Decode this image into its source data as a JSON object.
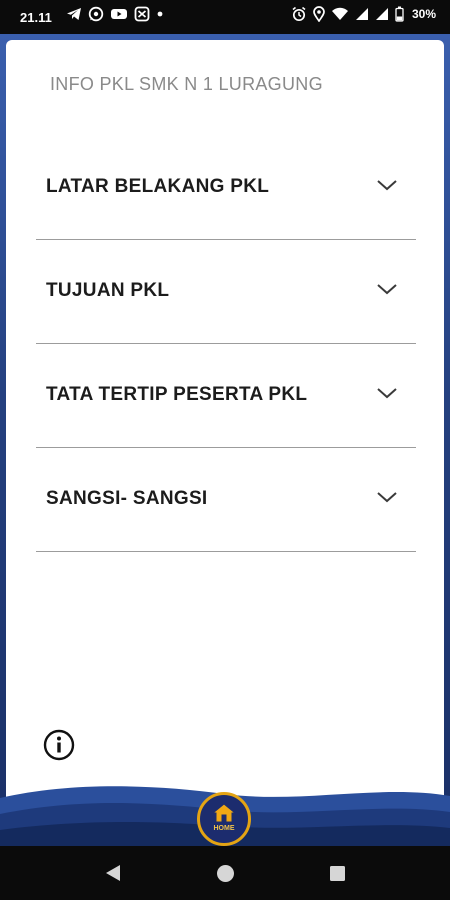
{
  "status_bar": {
    "time": "21.11",
    "battery": "30%",
    "icons": [
      "telegram-icon",
      "whatsapp-icon",
      "youtube-icon",
      "capcut-icon",
      "dot-icon",
      "alarm-icon",
      "location-icon",
      "wifi-icon",
      "signal-icon",
      "signal-icon",
      "battery-icon"
    ]
  },
  "app": {
    "title": "INFO PKL SMK N 1 LURAGUNG",
    "sections": [
      {
        "label": "LATAR BELAKANG PKL"
      },
      {
        "label": "TUJUAN PKL"
      },
      {
        "label": "TATA TERTIP PESERTA PKL"
      },
      {
        "label": "SANGSI- SANGSI"
      }
    ],
    "home_button": {
      "label": "HOME"
    }
  },
  "colors": {
    "frame_blue": "#24407f",
    "home_ring": "#e4a414",
    "text_dark": "#1c1c1c",
    "title_gray": "#8a8a8a"
  },
  "nav_bar": {
    "icons": [
      "back-icon",
      "home-icon",
      "recents-icon"
    ]
  }
}
